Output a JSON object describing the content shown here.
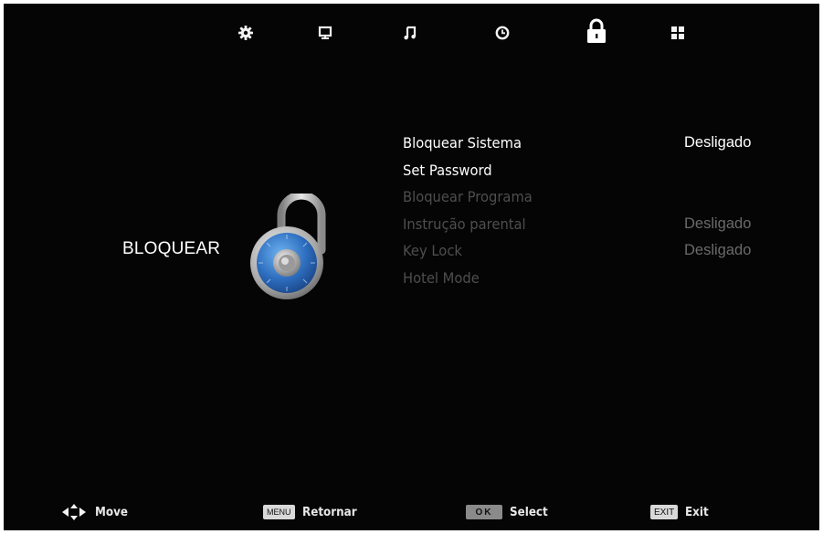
{
  "colors": {
    "background": "#050505",
    "text_active": "#ffffff",
    "text_disabled": "#4e4e4e",
    "lock_blue": "#2f6fc0"
  },
  "top_tabs": [
    {
      "icon": "gear-icon",
      "label": ""
    },
    {
      "icon": "monitor-icon",
      "label": ""
    },
    {
      "icon": "music-note-icon",
      "label": ""
    },
    {
      "icon": "clock-icon",
      "label": ""
    },
    {
      "icon": "padlock-icon",
      "label": "",
      "selected": true
    },
    {
      "icon": "grid-icon",
      "label": ""
    }
  ],
  "category": {
    "title": "BLOQUEAR",
    "icon": "combination-lock-icon"
  },
  "menu": {
    "items": [
      {
        "label": "Bloquear Sistema",
        "value": "Desligado",
        "state": "active"
      },
      {
        "label": "Set Password",
        "value": "",
        "state": "active"
      },
      {
        "label": "Bloquear Programa",
        "value": "",
        "state": "disabled"
      },
      {
        "label": "Instrução parental",
        "value": "Desligado",
        "state": "disabled"
      },
      {
        "label": "Key Lock",
        "value": "Desligado",
        "state": "disabled"
      },
      {
        "label": "Hotel Mode",
        "value": "",
        "state": "disabled"
      }
    ]
  },
  "hints": {
    "move": {
      "icon": "arrows-icon",
      "label": "Move"
    },
    "menu": {
      "key": "MENU",
      "label": "Retornar"
    },
    "ok": {
      "key": "OK",
      "label": "Select"
    },
    "exit": {
      "key": "EXIT",
      "label": "Exit"
    }
  }
}
